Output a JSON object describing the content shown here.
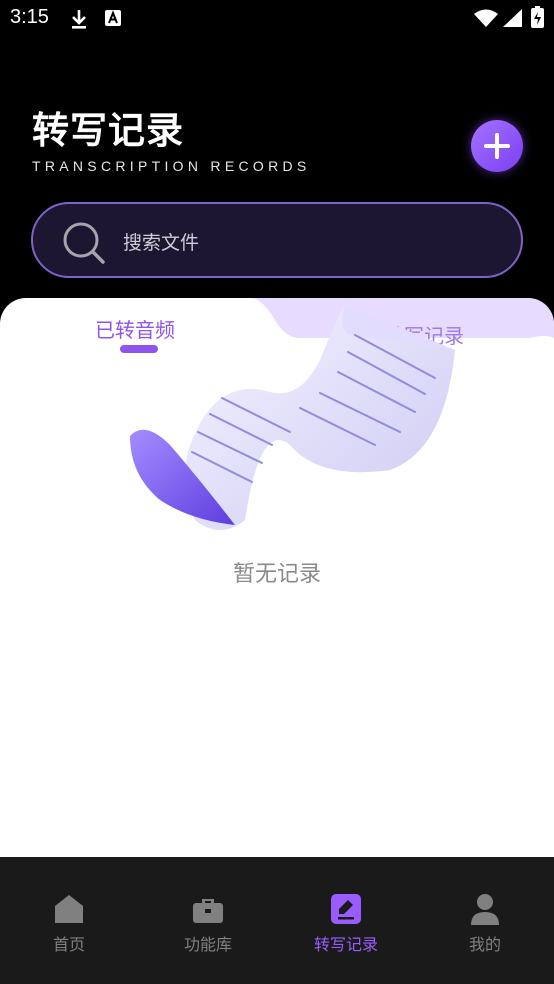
{
  "status_bar": {
    "time": "3:15"
  },
  "header": {
    "title": "转写记录",
    "subtitle": "TRANSCRIPTION RECORDS"
  },
  "search": {
    "placeholder": "搜索文件"
  },
  "tabs": [
    {
      "label": "已转音频",
      "active": true
    },
    {
      "label": "转写记录",
      "active": false
    }
  ],
  "empty_state": {
    "text": "暂无记录",
    "icon": "empty-document-illustration"
  },
  "bottom_nav": [
    {
      "label": "首页",
      "icon": "home-icon",
      "active": false
    },
    {
      "label": "功能库",
      "icon": "briefcase-icon",
      "active": false
    },
    {
      "label": "转写记录",
      "icon": "edit-note-icon",
      "active": true
    },
    {
      "label": "我的",
      "icon": "person-icon",
      "active": false
    }
  ],
  "colors": {
    "accent": "#8e55ee",
    "nav_active": "#9b5cff",
    "background": "#000000",
    "nav_background": "#1a1a1a"
  }
}
